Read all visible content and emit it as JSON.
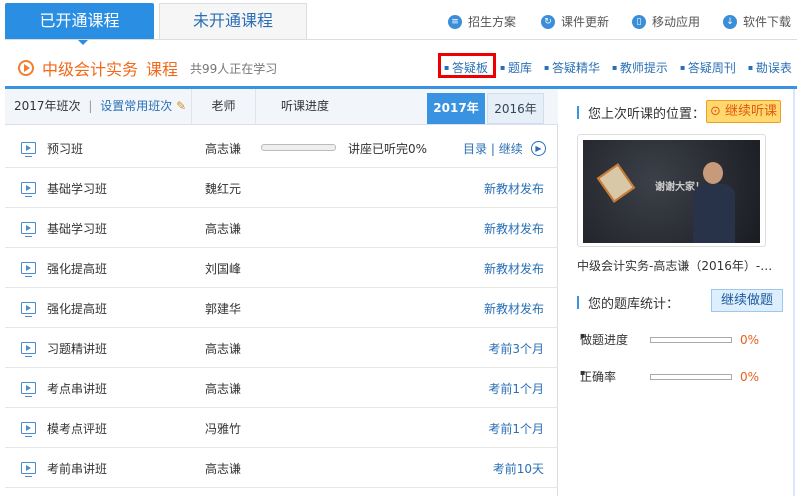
{
  "tabs": [
    {
      "label": "已开通课程",
      "active": true
    },
    {
      "label": "未开通课程",
      "active": false
    }
  ],
  "top_links": [
    {
      "label": "招生方案",
      "icon": "document-icon"
    },
    {
      "label": "课件更新",
      "icon": "refresh-icon"
    },
    {
      "label": "移动应用",
      "icon": "mobile-icon"
    },
    {
      "label": "软件下载",
      "icon": "download-icon"
    }
  ],
  "course": {
    "name": "中级会计实务",
    "suffix": "课程",
    "learners": "共99人正在学习"
  },
  "course_nav": [
    "答疑板",
    "题库",
    "答疑精华",
    "教师提示",
    "答疑周刊",
    "勘误表"
  ],
  "table_header": {
    "class_year": "2017年班次",
    "set_common": "设置常用班次",
    "teacher": "老师",
    "progress": "听课进度",
    "years": [
      {
        "label": "2017年",
        "active": true
      },
      {
        "label": "2016年",
        "active": false
      }
    ]
  },
  "rows": [
    {
      "name": "预习班",
      "teacher": "高志谦",
      "progress_text": "讲座已听完0%",
      "progress": 0,
      "links": [
        "目录",
        "继续"
      ]
    },
    {
      "name": "基础学习班",
      "teacher": "魏红元",
      "status": "新教材发布"
    },
    {
      "name": "基础学习班",
      "teacher": "高志谦",
      "status": "新教材发布"
    },
    {
      "name": "强化提高班",
      "teacher": "刘国峰",
      "status": "新教材发布"
    },
    {
      "name": "强化提高班",
      "teacher": "郭建华",
      "status": "新教材发布"
    },
    {
      "name": "习题精讲班",
      "teacher": "高志谦",
      "status": "考前3个月"
    },
    {
      "name": "考点串讲班",
      "teacher": "高志谦",
      "status": "考前1个月"
    },
    {
      "name": "模考点评班",
      "teacher": "冯雅竹",
      "status": "考前1个月"
    },
    {
      "name": "考前串讲班",
      "teacher": "高志谦",
      "status": "考前10天"
    }
  ],
  "sidebar": {
    "last_position": "您上次听课的位置：",
    "continue_listen": "继续听课",
    "video_caption": "中级会计实务-高志谦（2016年）-…",
    "video_text": "谢谢大家！",
    "bank_stats": "您的题库统计：",
    "continue_practice": "继续做题",
    "stats": [
      {
        "label": "做题进度",
        "value": "0%",
        "fraction": 0
      },
      {
        "label": "正确率",
        "value": "0%",
        "fraction": 0
      }
    ]
  }
}
